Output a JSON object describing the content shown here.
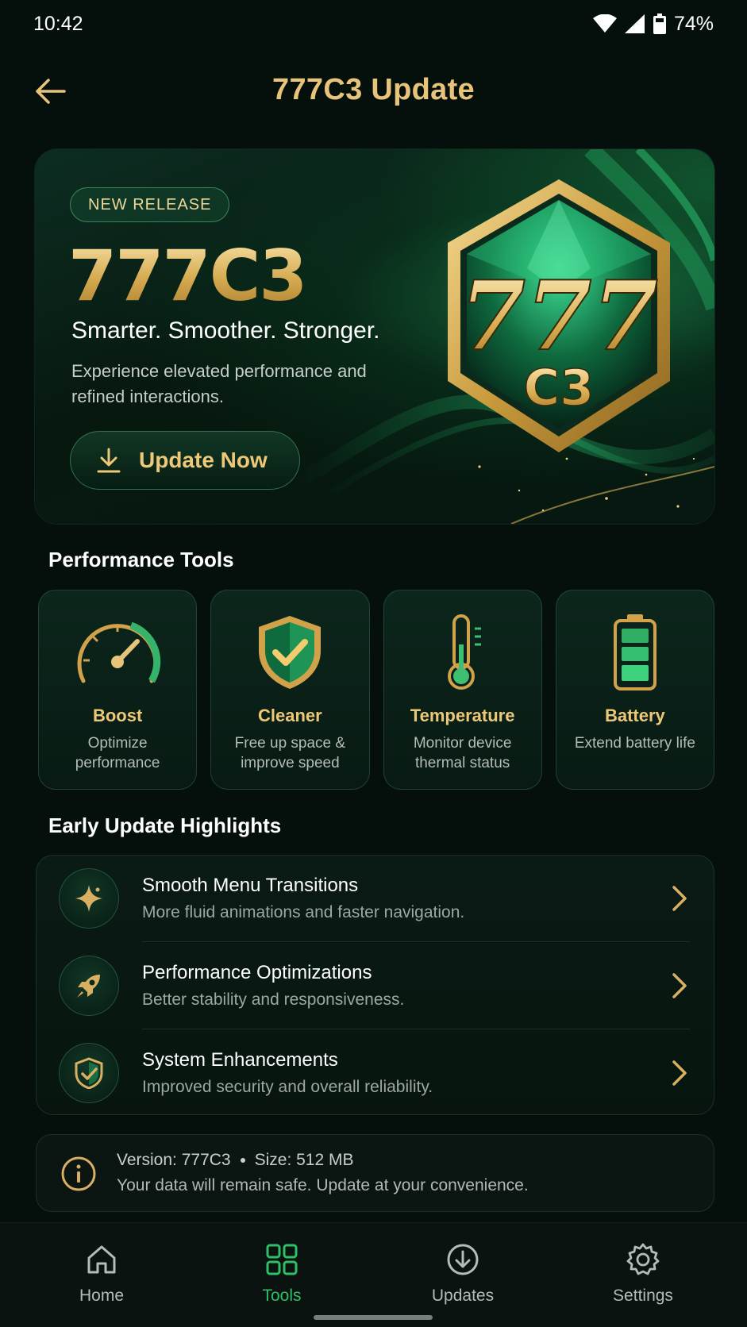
{
  "status": {
    "time": "10:42",
    "battery": "74%"
  },
  "header": {
    "title": "777C3 Update"
  },
  "hero": {
    "badge": "NEW RELEASE",
    "title": "777C3",
    "tagline": "Smarter. Smoother. Stronger.",
    "description": "Experience elevated performance and refined interactions.",
    "button_label": "Update Now",
    "emblem_top": "777",
    "emblem_bottom": "C3"
  },
  "tools": {
    "title": "Performance Tools",
    "items": [
      {
        "name": "Boost",
        "desc": "Optimize performance",
        "icon": "speedometer-icon"
      },
      {
        "name": "Cleaner",
        "desc": "Free up space & improve speed",
        "icon": "shield-check-icon"
      },
      {
        "name": "Temperature",
        "desc": "Monitor device thermal status",
        "icon": "thermometer-icon"
      },
      {
        "name": "Battery",
        "desc": "Extend battery life",
        "icon": "battery-icon"
      }
    ]
  },
  "highlights": {
    "title": "Early Update Highlights",
    "items": [
      {
        "title": "Smooth Menu Transitions",
        "subtitle": "More fluid animations and faster navigation.",
        "icon": "sparkle-icon"
      },
      {
        "title": "Performance Optimizations",
        "subtitle": "Better stability and responsiveness.",
        "icon": "rocket-icon"
      },
      {
        "title": "System Enhancements",
        "subtitle": "Improved security and overall reliability.",
        "icon": "shield-check-icon"
      }
    ]
  },
  "info": {
    "version": "Version: 777C3",
    "size": "Size: 512 MB",
    "note": "Your data will remain safe. Update at your convenience."
  },
  "nav": {
    "items": [
      {
        "label": "Home",
        "icon": "home-icon"
      },
      {
        "label": "Tools",
        "icon": "grid-icon",
        "active": true
      },
      {
        "label": "Updates",
        "icon": "download-circle-icon"
      },
      {
        "label": "Settings",
        "icon": "gear-icon"
      }
    ]
  },
  "colors": {
    "gold": "#e8c47a",
    "green_active": "#2fbf67",
    "background": "#05100d"
  }
}
